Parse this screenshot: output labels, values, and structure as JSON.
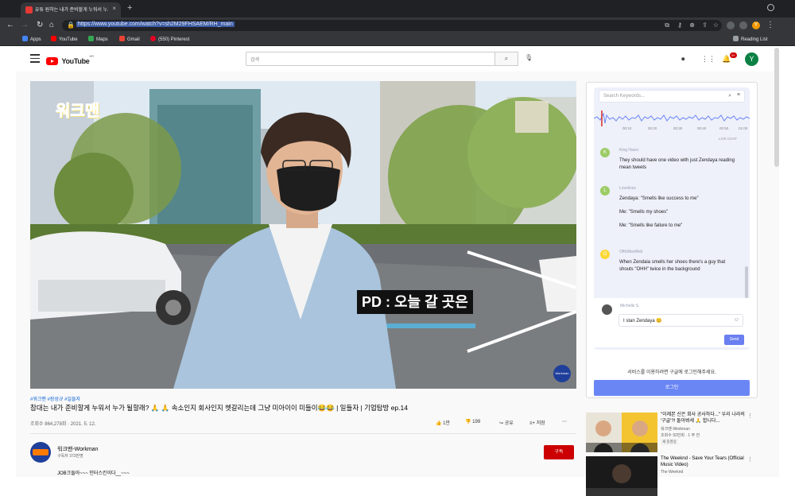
{
  "browser": {
    "tab_title": "유튜 원하는 내가 준비할게 누워서 누가...",
    "tab_close": "×",
    "new_tab": "+",
    "url": "https://www.youtube.com/watch?v=sh2M29FHSAEM/RH_main",
    "bookmarks": [
      {
        "label": "Apps",
        "color": "#4285f4"
      },
      {
        "label": "YouTube",
        "color": "#ff0000"
      },
      {
        "label": "Maps",
        "color": "#34a853"
      },
      {
        "label": "Gmail",
        "color": "#ea4335"
      },
      {
        "label": "(550) Pinterest",
        "color": "#e60023"
      }
    ],
    "reading_list": "Reading List",
    "profile_initial": "Y"
  },
  "youtube": {
    "logo_text": "YouTube",
    "logo_region": "KR",
    "search_placeholder": "검색",
    "notification_count": "9+",
    "avatar_initial": "Y"
  },
  "video": {
    "channel_logo": "워크맨",
    "caption": "PD : 오늘 갈 곳은",
    "watermark": "Workman",
    "tags": "#워크맨 #장성규 #일들자",
    "title": "참대는 내가 준비할게 누워서 누가 될할래? 🙏 🙏 속소인지 회사인지 헷갈리는데 그냥 미아이이 미들이😂😂 | 일들자 | 기업탐방 ep.14",
    "meta": "조회수 864,278회 · 2021. 5. 12.",
    "actions": {
      "like": "1만",
      "dislike": "199",
      "share": "공유",
      "save": "저장"
    },
    "channel_name": "워크맨-Workman",
    "subscribers": "구독자 373만명",
    "subscribe": "구독",
    "description": "JOB크들아~~~ 인터스킨이다__~~~"
  },
  "chat": {
    "search_placeholder": "Search Keywords...",
    "time_ticks": [
      "00:10",
      "00:20",
      "00:30",
      "00:40",
      "00:50",
      "01:00"
    ],
    "live_tag": "LIVE CHAT",
    "messages": [
      {
        "initial": "K",
        "name": "King Hassi",
        "text": "They should have one video with just Zendaya reading mean tweets",
        "color": "#9ccc65"
      },
      {
        "initial": "L",
        "name": "Lovelives",
        "text": "Zendaya: \"Smells like success to me\"\n\nMe: \"Smells my shoes\"\n\nMe: \"Smells like failure to me\"",
        "color": "#9ccc65"
      },
      {
        "initial": "O",
        "name": "OfthWeeWeli",
        "text": "When Zendaia smells her shoes there's a guy that shouts \"OHH\" twice in the background",
        "color": "#fdd835"
      }
    ],
    "reply_name": "Michelle S.",
    "reply_text": "I stan Zendaya 😊",
    "send": "Send",
    "login_note": "서비스를 이용하려면 구글에 로그인해주세요.",
    "login_button": "로그인"
  },
  "recommendations": [
    {
      "title": "\"이제본 신은 회사 공사하다...\" 우리 나라의 '구글'?! 돌아봐세 🙏 합니다...",
      "channel": "워크맨-Workman",
      "stats": "조회수 92만회 · 1 주 전",
      "tag": "새 동영상"
    },
    {
      "title": "The Weeknd - Save Your Tears (Official Music Video)",
      "channel": "The Weeknd",
      "stats": "",
      "tag": ""
    }
  ]
}
